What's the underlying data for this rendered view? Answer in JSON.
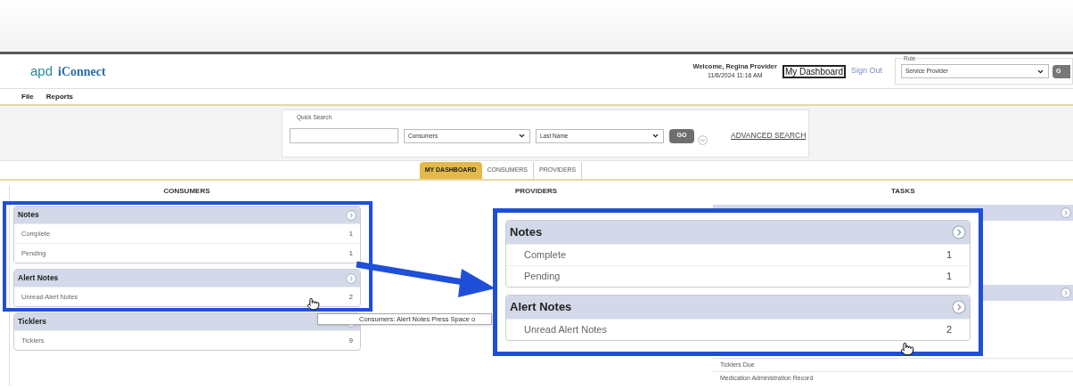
{
  "header": {
    "logo_mark": "apd",
    "logo_text": "iConnect",
    "welcome": "Welcome, Regina Provider",
    "datetime": "11/8/2024 11:16 AM",
    "dashboard_link": "My Dashboard",
    "sign_out": "Sign Out",
    "role": {
      "legend": "Role",
      "value": "Service Provider",
      "button": "G"
    }
  },
  "menu": [
    "File",
    "Reports"
  ],
  "quick_search": {
    "legend": "Quick Search",
    "type": "Consumers",
    "field": "Last Name",
    "button": "GO",
    "advanced": "ADVANCED SEARCH"
  },
  "tabs": [
    {
      "label": "MY DASHBOARD",
      "selected": true
    },
    {
      "label": "CONSUMERS",
      "selected": false
    },
    {
      "label": "PROVIDERS",
      "selected": false
    }
  ],
  "columns": [
    {
      "title": "CONSUMERS",
      "panels": [
        {
          "title": "Notes",
          "rows": [
            {
              "label": "Complete",
              "count": "1"
            },
            {
              "label": "Pending",
              "count": "1"
            }
          ]
        },
        {
          "title": "Alert Notes",
          "rows": [
            {
              "label": "Unread Alert Notes",
              "count": "2"
            }
          ]
        },
        {
          "title": "Ticklers",
          "rows": [
            {
              "label": "Ticklers",
              "count": "9"
            }
          ]
        }
      ]
    },
    {
      "title": "PROVIDERS"
    },
    {
      "title": "TASKS",
      "rows": [
        "Ticklers Due",
        "Medication Administration Record"
      ]
    }
  ],
  "tooltip": "Consumers: Alert Notes Press Space o",
  "callout": {
    "panels": [
      {
        "title": "Notes",
        "rows": [
          {
            "label": "Complete",
            "count": "1"
          },
          {
            "label": "Pending",
            "count": "1"
          }
        ]
      },
      {
        "title": "Alert Notes",
        "rows": [
          {
            "label": "Unread Alert Notes",
            "count": "2"
          }
        ]
      }
    ]
  }
}
